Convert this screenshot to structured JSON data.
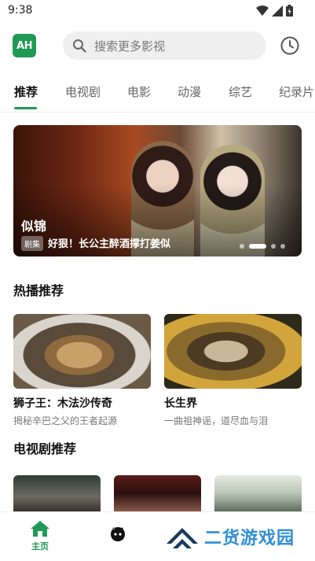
{
  "status": {
    "time": "9:38"
  },
  "header": {
    "logo_text": "AH",
    "search_placeholder": "搜索更多影视"
  },
  "tabs": [
    {
      "label": "推荐",
      "active": true
    },
    {
      "label": "电视剧"
    },
    {
      "label": "电影"
    },
    {
      "label": "动漫"
    },
    {
      "label": "综艺"
    },
    {
      "label": "纪录片"
    }
  ],
  "banner": {
    "title": "似锦",
    "tag": "剧集",
    "subtitle": "好狠！长公主醉酒撑打姜似"
  },
  "hot": {
    "title": "热播推荐",
    "items": [
      {
        "title": "狮子王：木法沙传奇",
        "desc": "揭秘辛巴之父的王者起源"
      },
      {
        "title": "长生界",
        "desc": "一曲祖神谣，道尽血与泪"
      }
    ]
  },
  "drama": {
    "title": "电视剧推荐"
  },
  "nav": {
    "home_label": "主页"
  },
  "watermark": {
    "text": "二货游戏园"
  },
  "colors": {
    "accent": "#1f9a55",
    "watermark": "#2f8fd6"
  }
}
